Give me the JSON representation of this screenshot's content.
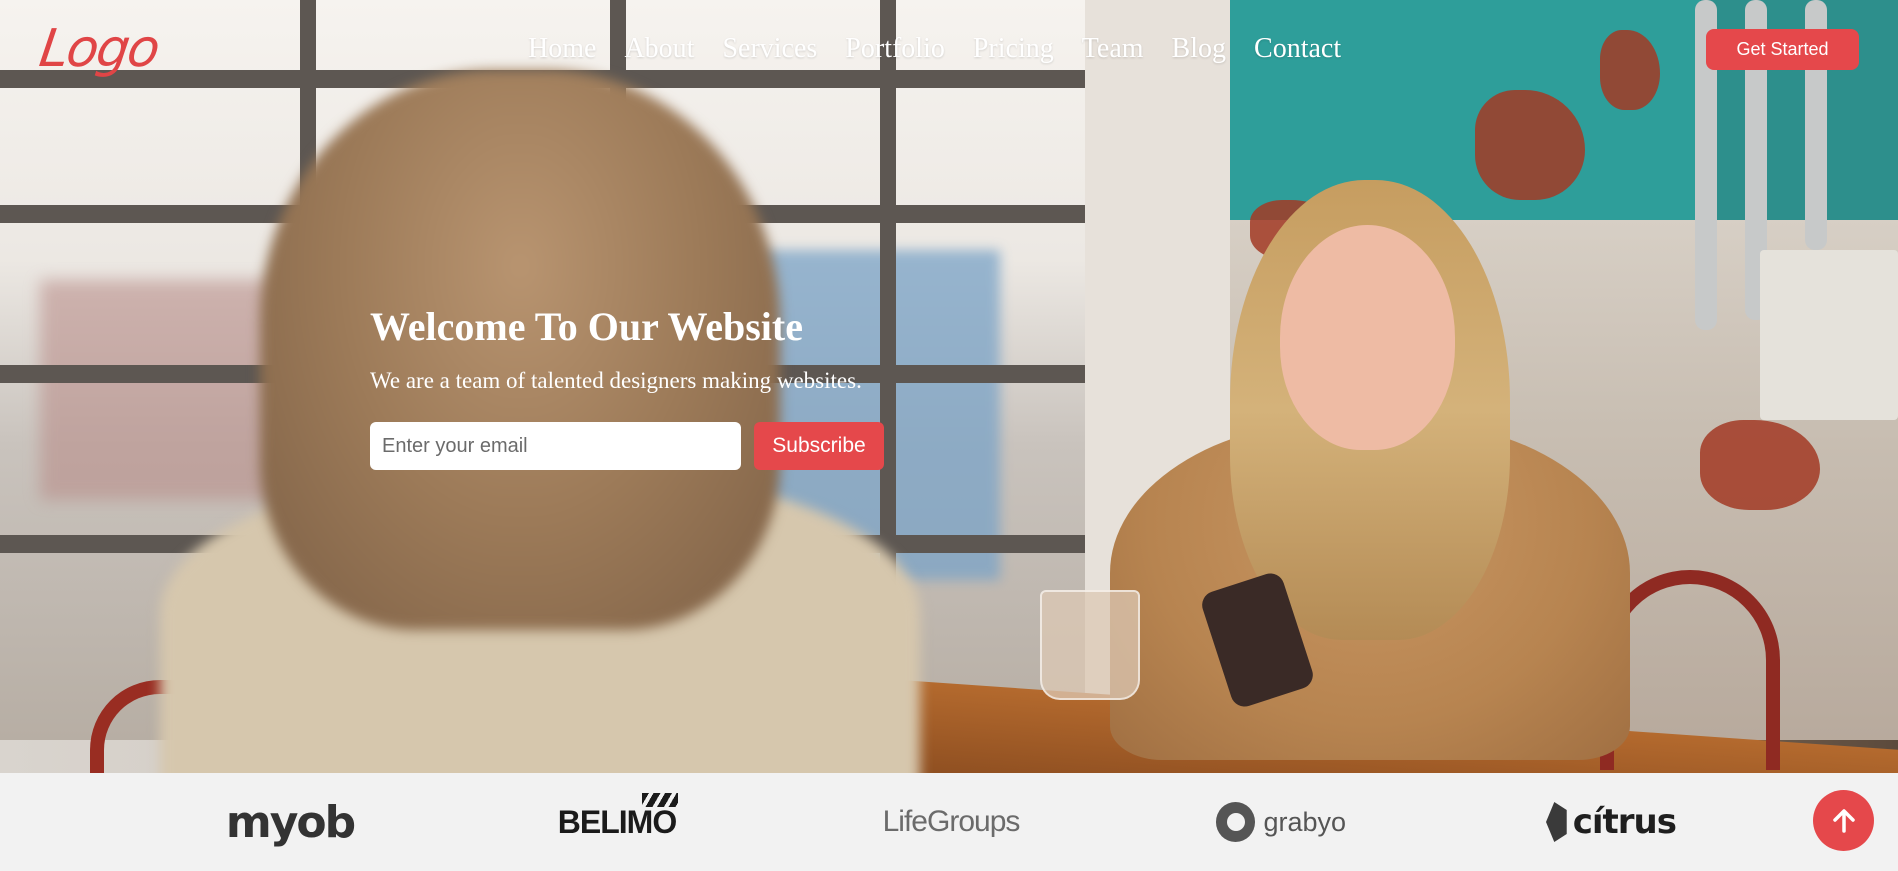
{
  "header": {
    "logo_text": "LOGO",
    "nav": [
      {
        "label": "Home"
      },
      {
        "label": "About"
      },
      {
        "label": "Services"
      },
      {
        "label": "Portfolio"
      },
      {
        "label": "Pricing"
      },
      {
        "label": "Team"
      },
      {
        "label": "Blog"
      },
      {
        "label": "Contact"
      }
    ],
    "cta_label": "Get Started"
  },
  "hero": {
    "title": "Welcome To Our Website",
    "subtitle": "We are a team of talented designers making websites.",
    "email_placeholder": "Enter your email",
    "subscribe_label": "Subscribe"
  },
  "clients": [
    {
      "name": "myob"
    },
    {
      "name": "BELIMO"
    },
    {
      "name": "LifeGroups"
    },
    {
      "name": "grabyo"
    },
    {
      "name": "cítrus"
    }
  ],
  "scroll_top_icon": "arrow-up-icon",
  "colors": {
    "accent": "#e5484b",
    "logo": "#e04546",
    "clients_bg": "#f2f2f2"
  }
}
